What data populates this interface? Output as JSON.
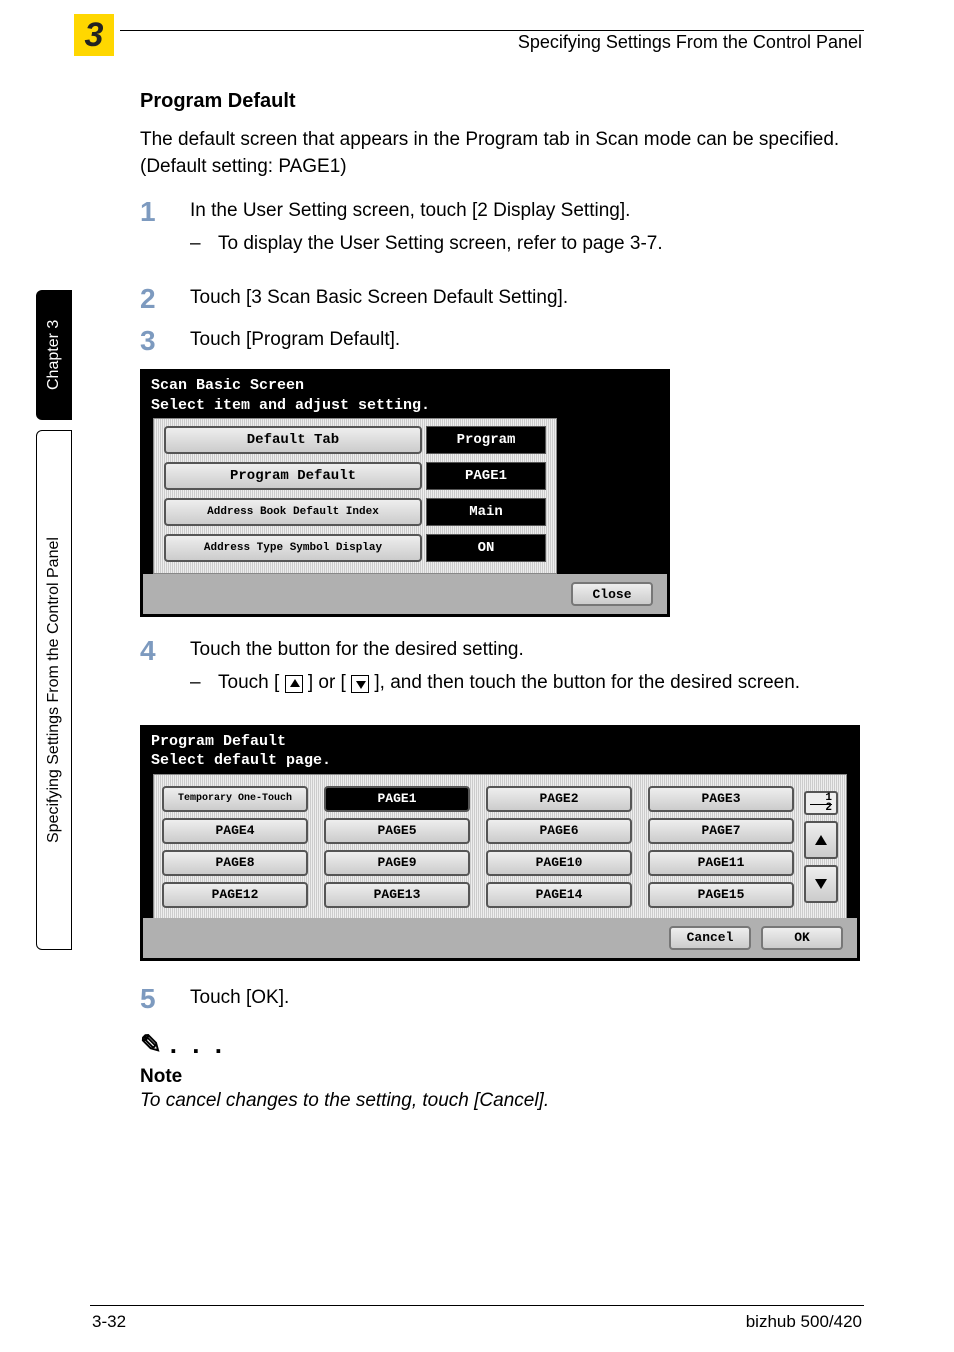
{
  "header": {
    "chapter_num": "3",
    "title": "Specifying Settings From the Control Panel"
  },
  "sidebar": {
    "tab_black": "Chapter 3",
    "tab_outline": "Specifying Settings From the Control Panel"
  },
  "section_title": "Program Default",
  "intro": "The default screen that appears in the Program tab in Scan mode can be specified. (Default setting: PAGE1)",
  "steps": {
    "s1": "In the User Setting screen, touch [2 Display Setting].",
    "s1_sub": "To display the User Setting screen, refer to page 3-7.",
    "s2": "Touch [3 Scan Basic Screen Default Setting].",
    "s3": "Touch [Program Default].",
    "s4": "Touch the button for the desired setting.",
    "s4_sub_a": "Touch [ ",
    "s4_sub_b": " ] or [ ",
    "s4_sub_c": " ], and then touch the button for the desired screen.",
    "s5": "Touch [OK]."
  },
  "panel1": {
    "title1": "Scan Basic Screen",
    "title2": "Select item and adjust setting.",
    "rows": [
      {
        "left": "Default Tab",
        "right": "Program"
      },
      {
        "left": "Program Default",
        "right": "PAGE1"
      },
      {
        "left": "Address Book Default Index",
        "right": "Main"
      },
      {
        "left": "Address Type Symbol Display",
        "right": "ON"
      }
    ],
    "close": "Close"
  },
  "panel2": {
    "title1": "Program Default",
    "title2": "Select default page.",
    "buttons": [
      "Temporary One-Touch",
      "PAGE1",
      "PAGE2",
      "PAGE3",
      "PAGE4",
      "PAGE5",
      "PAGE6",
      "PAGE7",
      "PAGE8",
      "PAGE9",
      "PAGE10",
      "PAGE11",
      "PAGE12",
      "PAGE13",
      "PAGE14",
      "PAGE15"
    ],
    "selected_index": 1,
    "scroll_ind": "1 / 2",
    "cancel": "Cancel",
    "ok": "OK"
  },
  "note": {
    "dots": ". . .",
    "heading": "Note",
    "text": "To cancel changes to the setting, touch [Cancel]."
  },
  "footer": {
    "left": "3-32",
    "right": "bizhub 500/420"
  }
}
